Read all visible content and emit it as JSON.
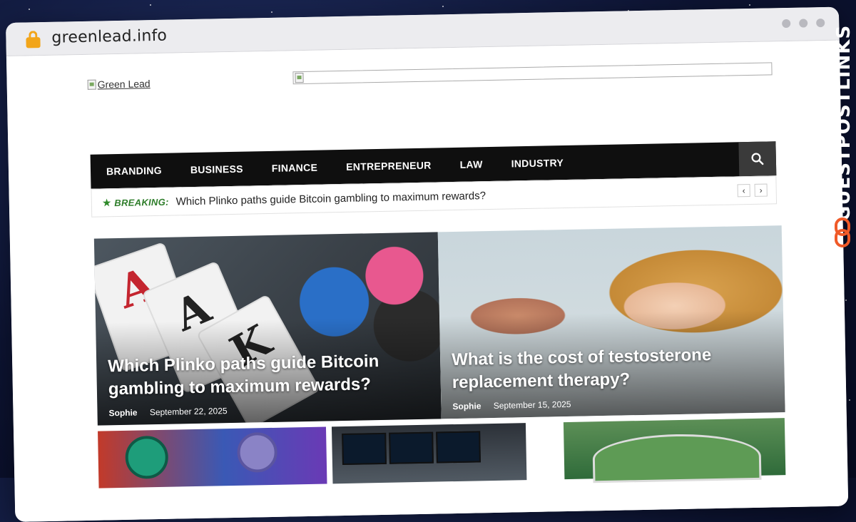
{
  "browser": {
    "url": "greenlead.info"
  },
  "site": {
    "logo_alt": "Green Lead"
  },
  "nav": {
    "items": [
      "BRANDING",
      "BUSINESS",
      "FINANCE",
      "ENTREPRENEUR",
      "LAW",
      "INDUSTRY"
    ]
  },
  "breaking": {
    "label": "BREAKING:",
    "headline": "Which Plinko paths guide Bitcoin gambling to maximum rewards?"
  },
  "featured": [
    {
      "title": "Which Plinko paths guide Bitcoin gambling to maximum rewards?",
      "author": "Sophie",
      "date": "September 22, 2025"
    },
    {
      "title": "What is the cost of testosterone replacement therapy?",
      "author": "Sophie",
      "date": "September 15, 2025"
    }
  ],
  "side_brand": {
    "name": "GUESTPOSTLINKS"
  },
  "colors": {
    "accent_green": "#2e7d2a",
    "nav_bg": "#0f0f0f",
    "brand_orange": "#f05a28"
  }
}
